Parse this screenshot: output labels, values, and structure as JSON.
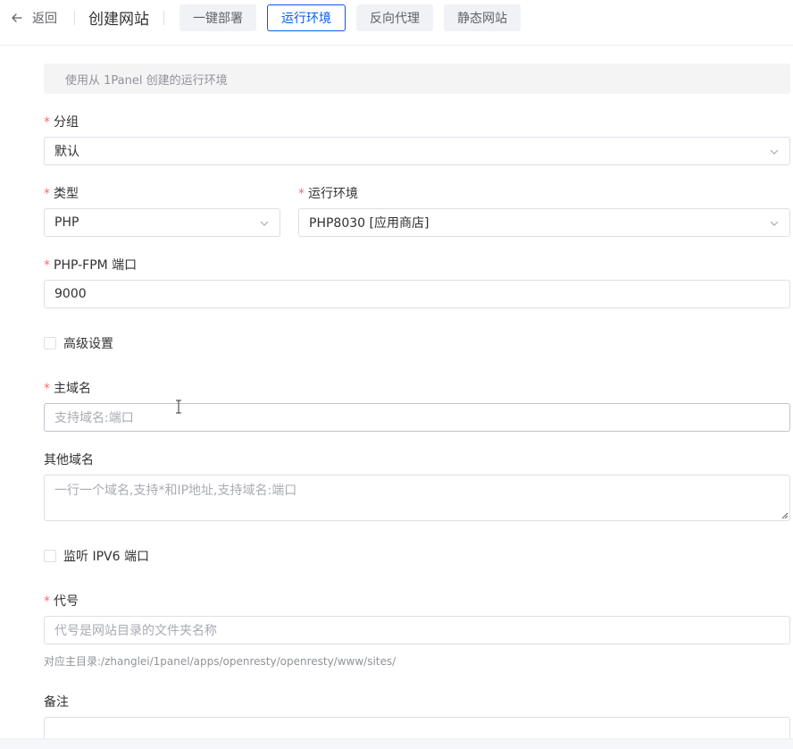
{
  "header": {
    "back_label": "返回",
    "title": "创建网站",
    "tabs": [
      {
        "label": "一键部署",
        "active": false
      },
      {
        "label": "运行环境",
        "active": true
      },
      {
        "label": "反向代理",
        "active": false
      },
      {
        "label": "静态网站",
        "active": false
      }
    ]
  },
  "notice": "使用从 1Panel 创建的运行环境",
  "form": {
    "group": {
      "label": "分组",
      "required": true,
      "value": "默认"
    },
    "type": {
      "label": "类型",
      "required": true,
      "value": "PHP"
    },
    "runtime": {
      "label": "运行环境",
      "required": true,
      "value": "PHP8030 [应用商店]"
    },
    "fpm_port": {
      "label": "PHP-FPM 端口",
      "required": true,
      "value": "9000"
    },
    "advanced": {
      "label": "高级设置",
      "checked": false
    },
    "primary_domain": {
      "label": "主域名",
      "required": true,
      "placeholder": "支持域名:端口"
    },
    "other_domains": {
      "label": "其他域名",
      "placeholder": "一行一个域名,支持*和IP地址,支持域名:端口"
    },
    "ipv6": {
      "label": "监听 IPV6 端口",
      "checked": false
    },
    "alias": {
      "label": "代号",
      "required": true,
      "placeholder": "代号是网站目录的文件夹名称"
    },
    "alias_hint": "对应主目录:/zhanglei/1panel/apps/openresty/openresty/www/sites/",
    "remark": {
      "label": "备注"
    }
  },
  "colors": {
    "primary": "#005eeb",
    "required": "#f56c6c",
    "border": "#dcdfe6",
    "placeholder": "#a8abb2"
  }
}
